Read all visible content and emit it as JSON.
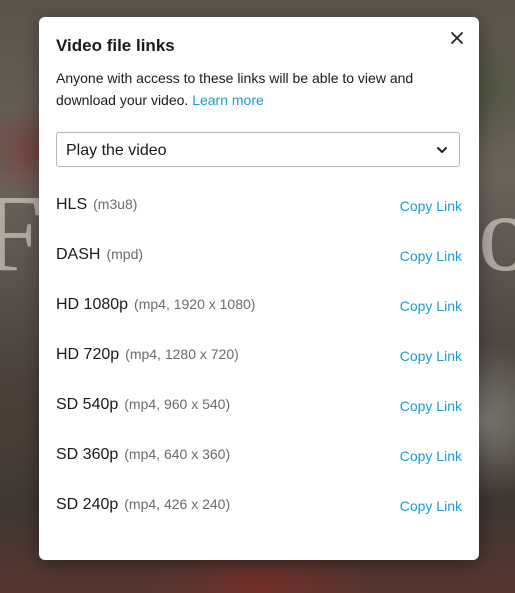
{
  "modal": {
    "title": "Video file links",
    "description": "Anyone with access to these links will be able to view and download your video.",
    "learn_more": "Learn more",
    "close_icon": "close-icon"
  },
  "select": {
    "value": "Play the video",
    "chevron_icon": "chevron-down-icon"
  },
  "links": [
    {
      "name": "HLS",
      "meta": "(m3u8)",
      "action": "Copy Link"
    },
    {
      "name": "DASH",
      "meta": "(mpd)",
      "action": "Copy Link"
    },
    {
      "name": "HD 1080p",
      "meta": "(mp4, 1920 x 1080)",
      "action": "Copy Link"
    },
    {
      "name": "HD 720p",
      "meta": "(mp4, 1280 x 720)",
      "action": "Copy Link"
    },
    {
      "name": "SD 540p",
      "meta": "(mp4, 960 x 540)",
      "action": "Copy Link"
    },
    {
      "name": "SD 360p",
      "meta": "(mp4, 640 x 360)",
      "action": "Copy Link"
    },
    {
      "name": "SD 240p",
      "meta": "(mp4, 426 x 240)",
      "action": "Copy Link"
    }
  ],
  "colors": {
    "link": "#1a9bd7",
    "text": "#1a1a1a",
    "muted": "#6b6b6b"
  }
}
